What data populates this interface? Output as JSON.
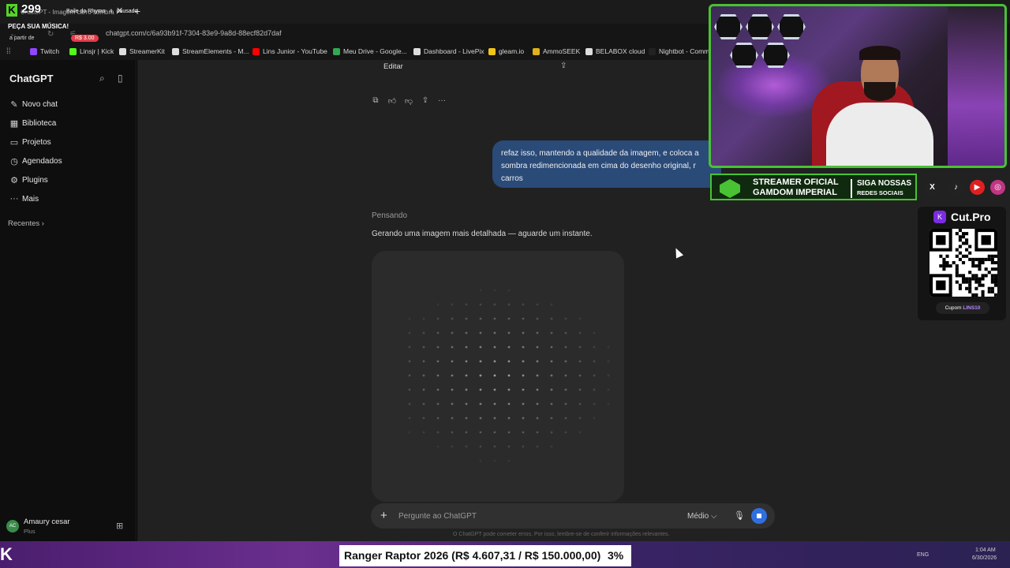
{
  "browser": {
    "tab_title": "ChatGPT - Imagem carro sombra",
    "url": "chatgpt.com/c/6a93b91f-7304-83e9-9a8d-88ecf82d7daf",
    "bookmarks": [
      {
        "label": "Twitch",
        "color": "#9146ff"
      },
      {
        "label": "Linsjr | Kick",
        "color": "#53fc18"
      },
      {
        "label": "StreamerKit",
        "color": "#dddddd"
      },
      {
        "label": "StreamElements - M...",
        "color": "#dddddd"
      },
      {
        "label": "Lins Junior - YouTube",
        "color": "#ff0000"
      },
      {
        "label": "Meu Drive - Google...",
        "color": "#34a853"
      },
      {
        "label": "Dashboard - LivePix",
        "color": "#dddddd"
      },
      {
        "label": "gleam.io",
        "color": "#f0c419"
      },
      {
        "label": "AmmoSEEK",
        "color": "#e0b21a"
      },
      {
        "label": "BELABOX cloud",
        "color": "#dddddd"
      },
      {
        "label": "Nightbot - Comm",
        "color": "#222222"
      }
    ]
  },
  "overlay": {
    "count": "299",
    "song_label": "Baile do Rhymo",
    "paused": "pausado",
    "request_title": "PEÇA SUA MÚSICA!",
    "from_label": "a partir de",
    "price": "R$ 3.00"
  },
  "sidebar": {
    "title": "ChatGPT",
    "items": [
      {
        "label": "Novo chat",
        "icon": "✎"
      },
      {
        "label": "Biblioteca",
        "icon": "▦"
      },
      {
        "label": "Projetos",
        "icon": "▭"
      },
      {
        "label": "Agendados",
        "icon": "◷"
      },
      {
        "label": "Plugins",
        "icon": "⚙"
      },
      {
        "label": "Mais",
        "icon": "···"
      }
    ],
    "recentes": "Recentes ›",
    "user": {
      "name": "Amaury cesar",
      "plan": "Plus",
      "initials": "AC"
    }
  },
  "chat": {
    "edit_label": "Editar",
    "user_message": "refaz isso, mantendo a qualidade da imagem, e coloca a sombra redimencionada em cima do desenho original, r carros",
    "thinking": "Pensando",
    "generating": "Gerando uma imagem mais detalhada — aguarde um instante.",
    "composer_placeholder": "Pergunte ao ChatGPT",
    "model": "Médio ⌵",
    "disclaimer": "O ChatGPT pode cometer erros. Por isso, lembre-se de conferir informações relevantes."
  },
  "stream": {
    "banner_line1": "STREAMER OFICIAL",
    "banner_line2": "GAMDOM IMPERIAL",
    "banner_line3": "SIGA NOSSAS",
    "banner_line4": "REDES SOCIAIS",
    "socials": [
      {
        "icon": "x-icon",
        "glyph": "X",
        "color": "#222222"
      },
      {
        "icon": "tiktok-icon",
        "glyph": "♪",
        "color": "#222222"
      },
      {
        "icon": "youtube-icon",
        "glyph": "▶",
        "color": "#e02020"
      },
      {
        "icon": "instagram-icon",
        "glyph": "◎",
        "color": "#c13584"
      }
    ],
    "cut_name": "Cut.Pro",
    "cupom_label": "Cupom",
    "cupom_code": "LINS10",
    "ticker_text": "Ranger Raptor 2026 (R$ 4.607,31 / R$ 150.000,00)",
    "ticker_pct": "3%"
  },
  "taskbar": {
    "lang": "ENG",
    "time": "1:04 AM",
    "date": "6/30/2026"
  }
}
